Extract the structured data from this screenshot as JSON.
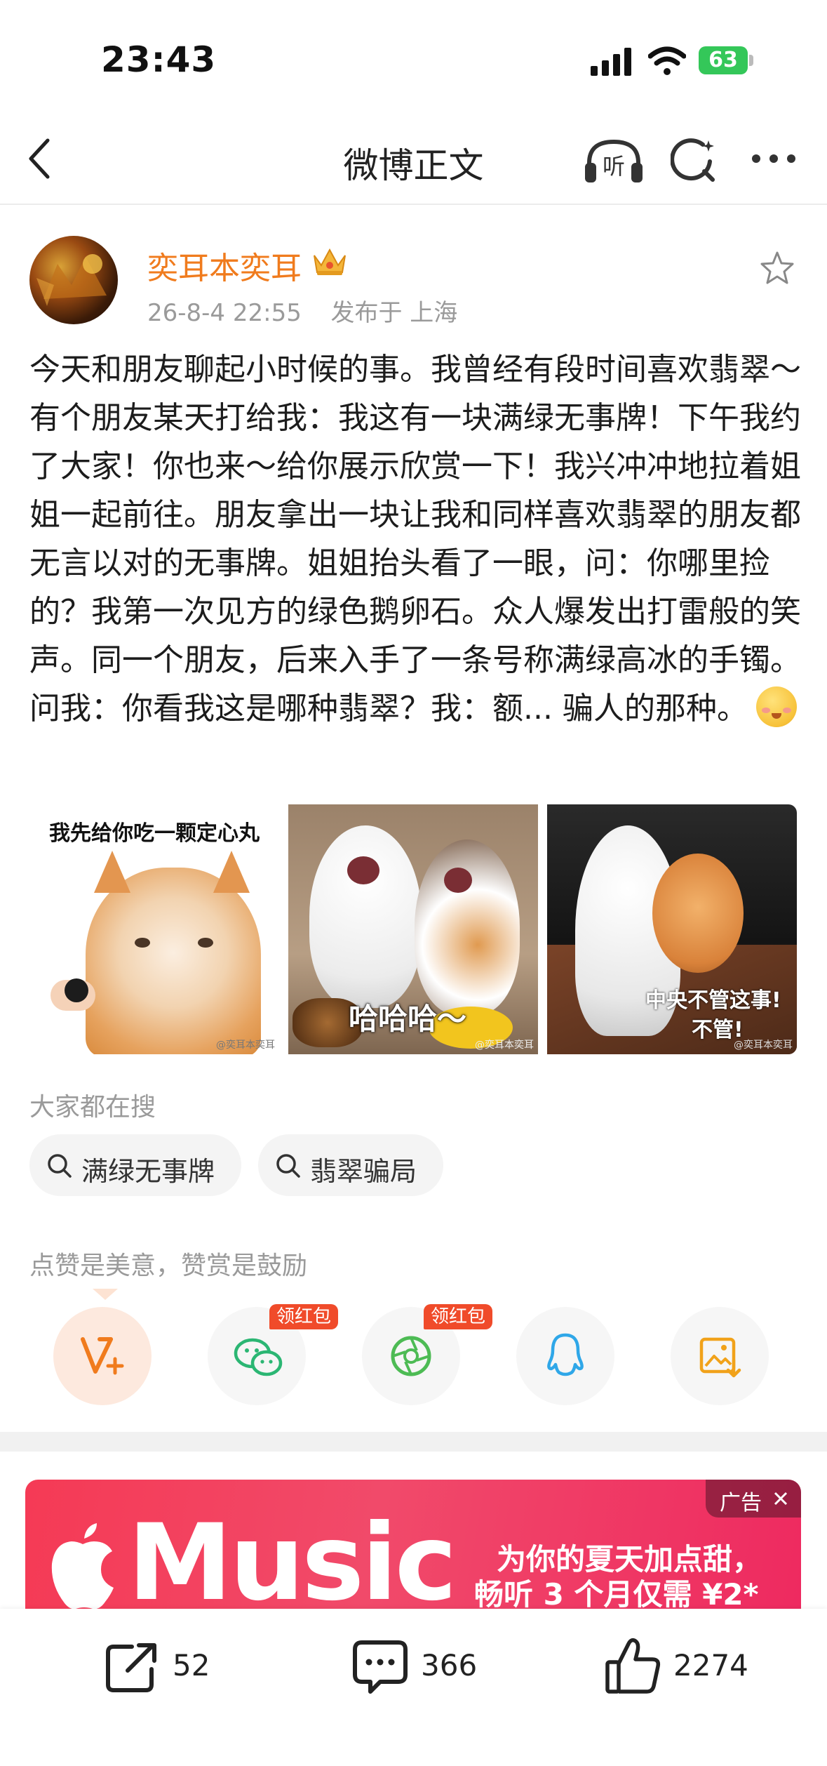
{
  "status_bar": {
    "time": "23:43",
    "battery": "63"
  },
  "nav": {
    "title": "微博正文",
    "listen_label": "听"
  },
  "author": {
    "name": "奕耳本奕耳",
    "date": "26-8-4 22:55",
    "location": "发布于 上海"
  },
  "post": {
    "text": "今天和朋友聊起小时候的事。我曾经有段时间喜欢翡翠～有个朋友某天打给我：我这有一块满绿无事牌！下午我约了大家！你也来～给你展示欣赏一下！我兴冲冲地拉着姐姐一起前往。朋友拿出一块让我和同样喜欢翡翠的朋友都无言以对的无事牌。姐姐抬头看了一眼，问：你哪里捡的？我第一次见方的绿色鹅卵石。众人爆发出打雷般的笑声。同一个朋友，后来入手了一条号称满绿高冰的手镯。问我：你看我这是哪种翡翠？我：额... 骗人的那种。"
  },
  "images": [
    {
      "caption": "我先给你吃一颗定心丸",
      "watermark": "@奕耳本奕耳"
    },
    {
      "caption": "哈哈哈～",
      "watermark": "@奕耳本奕耳"
    },
    {
      "caption_line1": "中央不管这事!",
      "caption_line2": "不管!",
      "watermark": "@奕耳本奕耳"
    }
  ],
  "search": {
    "label": "大家都在搜",
    "items": [
      "满绿无事牌",
      "翡翠骗局"
    ]
  },
  "reward": {
    "label": "点赞是美意，赞赏是鼓励",
    "badge": "领红包"
  },
  "ad": {
    "tag": "广告",
    "brand": "Music",
    "line1": "为你的夏天加点甜，",
    "line2": "畅听 3 个月仅需 ¥2*"
  },
  "bottom_bar": {
    "reposts": "52",
    "comments": "366",
    "likes": "2274"
  },
  "colors": {
    "accent": "#f07b1d",
    "badge": "#f04b2a",
    "wechat": "#2bb673",
    "qq": "#2fa7e8",
    "save": "#f1a21a"
  }
}
